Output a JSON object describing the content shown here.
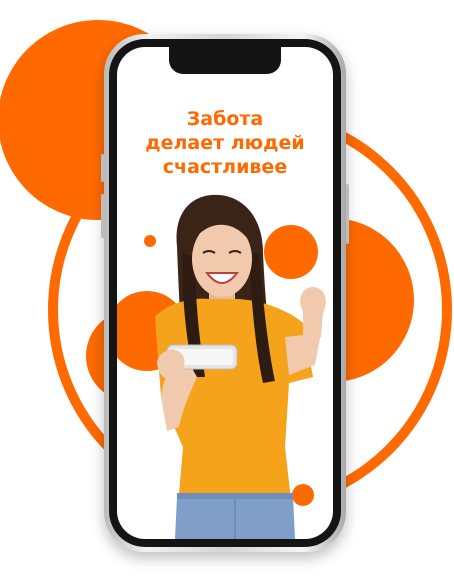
{
  "promo": {
    "headline_line1": "Забота",
    "headline_line2": "делает людей",
    "headline_line3": "счастливее"
  },
  "colors": {
    "accent": "#ff6a00",
    "shirt": "#f5a31a",
    "hair": "#3a2418",
    "skin": "#f1c9ad",
    "jeans": "#7f9ec8"
  },
  "illustration": {
    "subject": "woman-holding-smartphone"
  }
}
